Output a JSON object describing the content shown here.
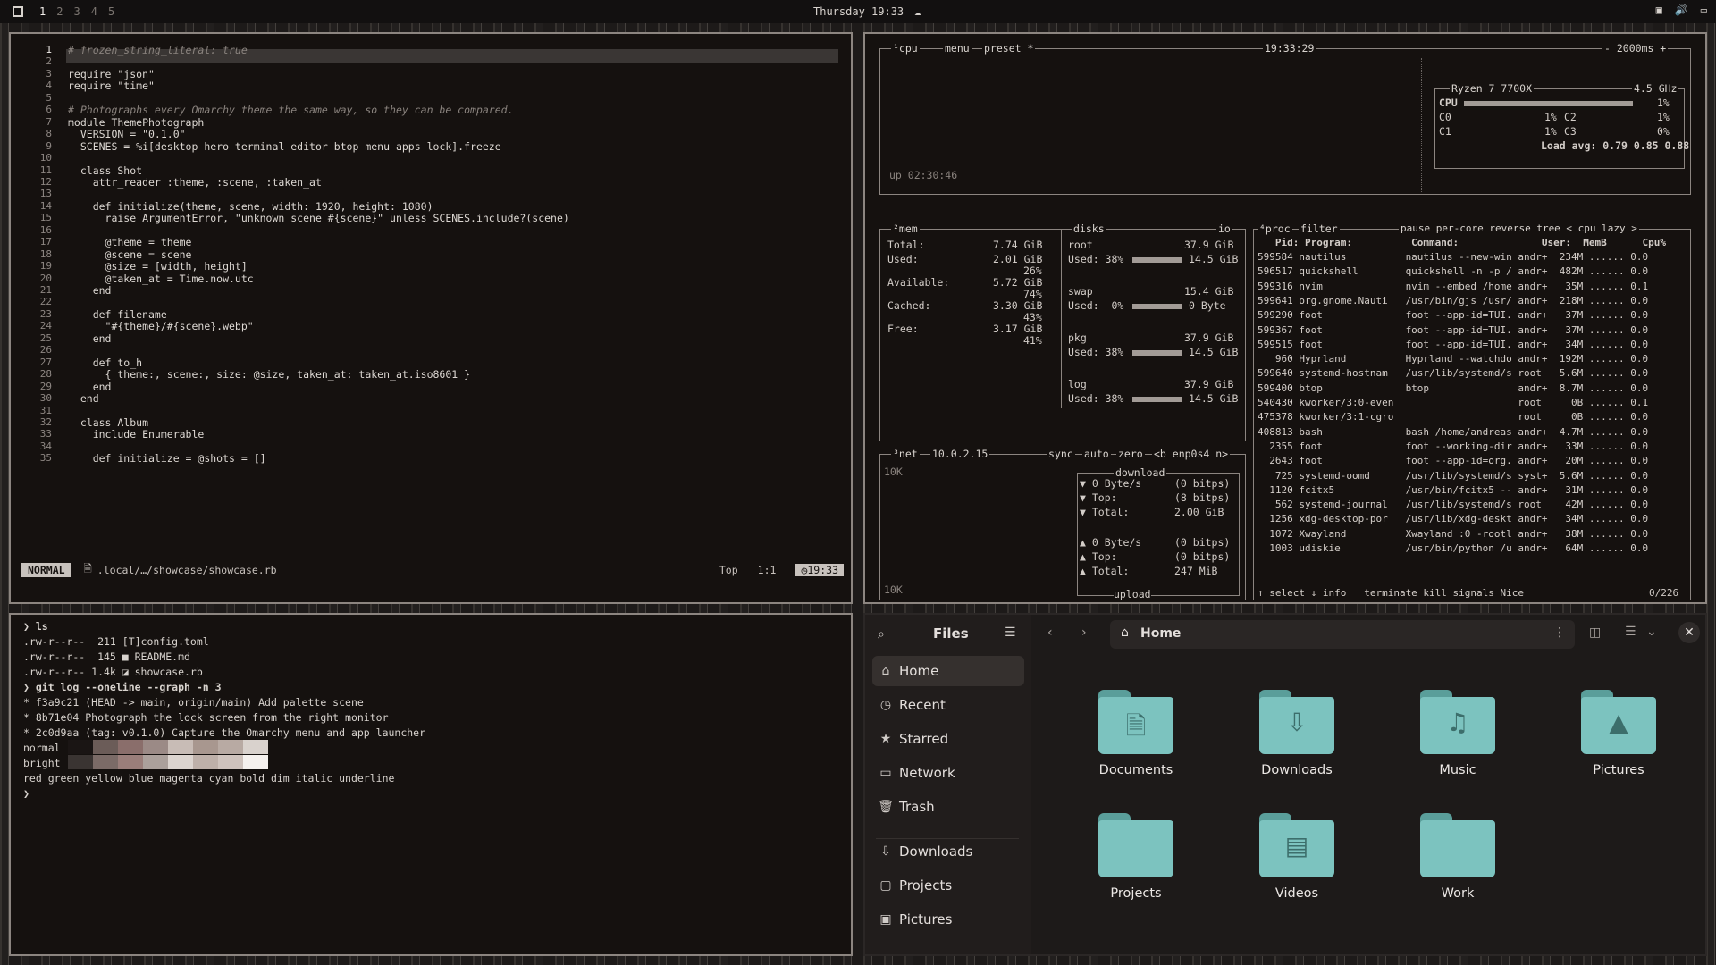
{
  "topbar": {
    "workspaces": [
      "1",
      "2",
      "3",
      "4",
      "5"
    ],
    "active": "1",
    "clock": "Thursday 19:33",
    "clock_icon": "cloud-icon",
    "tray": [
      "screen-icon",
      "volume-icon",
      "display-icon"
    ]
  },
  "editor": {
    "lines": [
      {
        "n": "1",
        "t": "# frozen_string_literal: true"
      },
      {
        "n": "2",
        "t": ""
      },
      {
        "n": "3",
        "t": "require \"json\""
      },
      {
        "n": "4",
        "t": "require \"time\""
      },
      {
        "n": "5",
        "t": ""
      },
      {
        "n": "6",
        "t": "# Photographs every Omarchy theme the same way, so they can be compared."
      },
      {
        "n": "7",
        "t": "module ThemePhotograph"
      },
      {
        "n": "8",
        "t": "  VERSION = \"0.1.0\""
      },
      {
        "n": "9",
        "t": "  SCENES = %i[desktop hero terminal editor btop menu apps lock].freeze"
      },
      {
        "n": "10",
        "t": ""
      },
      {
        "n": "11",
        "t": "  class Shot"
      },
      {
        "n": "12",
        "t": "    attr_reader :theme, :scene, :taken_at"
      },
      {
        "n": "13",
        "t": ""
      },
      {
        "n": "14",
        "t": "    def initialize(theme, scene, width: 1920, height: 1080)"
      },
      {
        "n": "15",
        "t": "      raise ArgumentError, \"unknown scene #{scene}\" unless SCENES.include?(scene)"
      },
      {
        "n": "16",
        "t": ""
      },
      {
        "n": "17",
        "t": "      @theme = theme"
      },
      {
        "n": "18",
        "t": "      @scene = scene"
      },
      {
        "n": "19",
        "t": "      @size = [width, height]"
      },
      {
        "n": "20",
        "t": "      @taken_at = Time.now.utc"
      },
      {
        "n": "21",
        "t": "    end"
      },
      {
        "n": "22",
        "t": ""
      },
      {
        "n": "23",
        "t": "    def filename"
      },
      {
        "n": "24",
        "t": "      \"#{theme}/#{scene}.webp\""
      },
      {
        "n": "25",
        "t": "    end"
      },
      {
        "n": "26",
        "t": ""
      },
      {
        "n": "27",
        "t": "    def to_h"
      },
      {
        "n": "28",
        "t": "      { theme:, scene:, size: @size, taken_at: taken_at.iso8601 }"
      },
      {
        "n": "29",
        "t": "    end"
      },
      {
        "n": "30",
        "t": "  end"
      },
      {
        "n": "31",
        "t": ""
      },
      {
        "n": "32",
        "t": "  class Album"
      },
      {
        "n": "33",
        "t": "    include Enumerable"
      },
      {
        "n": "34",
        "t": ""
      },
      {
        "n": "35",
        "t": "    def initialize = @shots = []"
      }
    ],
    "status": {
      "mode": "NORMAL",
      "path": ".local/…/showcase/showcase.rb",
      "pos": "Top",
      "cursor": "1:1",
      "time": "19:33"
    }
  },
  "terminal": {
    "lines": [
      "❯ ls",
      ".rw-r--r--  211 [T]config.toml",
      ".rw-r--r--  145 ■ README.md",
      ".rw-r--r-- 1.4k ◪ showcase.rb",
      "❯ git log --oneline --graph -n 3",
      "* f3a9c21 (HEAD -> main, origin/main) Add palette scene",
      "* 8b71e04 Photograph the lock screen from the right monitor",
      "* 2c0d9aa (tag: v0.1.0) Capture the Omarchy menu and app launcher",
      "normal",
      "bright",
      "red green yellow blue magenta cyan bold dim italic underline",
      "❯"
    ],
    "palette_normal": [
      "#1a1514",
      "#6b5c58",
      "#8a6e6b",
      "#9b8a86",
      "#c8bcb6",
      "#a8978f",
      "#b8aaa3",
      "#d9d2cd"
    ],
    "palette_bright": [
      "#3a3432",
      "#7b6b67",
      "#9a7e7a",
      "#aba09b",
      "#dcd4cf",
      "#beb0a9",
      "#cfc3bd",
      "#f5f1ee"
    ]
  },
  "btop": {
    "cpu": {
      "label": "¹cpu",
      "menu": "menu",
      "preset": "preset *",
      "time": "19:33:29",
      "interval": "- 2000ms +",
      "model": "Ryzen 7 7700X",
      "freq": "4.5 GHz",
      "uptime": "up 02:30:46",
      "rows": [
        {
          "name": "CPU",
          "pct": "1%",
          "fill": 0.9
        },
        {
          "name": "C0",
          "pct": "1%"
        },
        {
          "name": "C2",
          "pct": "1%"
        },
        {
          "name": "C1",
          "pct": "1%"
        },
        {
          "name": "C3",
          "pct": "0%"
        }
      ],
      "load": "Load avg: 0.79 0.85 0.88"
    },
    "mem": {
      "label": "²mem",
      "rows": [
        {
          "k": "Total:",
          "v": "7.74 GiB"
        },
        {
          "k": "Used:",
          "v": "2.01 GiB",
          "p": "26%"
        },
        {
          "k": "Available:",
          "v": "5.72 GiB",
          "p": "74%"
        },
        {
          "k": "Cached:",
          "v": "3.30 GiB",
          "p": "43%"
        },
        {
          "k": "Free:",
          "v": "3.17 GiB",
          "p": "41%"
        }
      ]
    },
    "disks": {
      "label": "disks",
      "io": "io",
      "rows": [
        {
          "name": "root",
          "size": "37.9 GiB",
          "used": "Used: 38%",
          "usize": "14.5 GiB"
        },
        {
          "name": "swap",
          "size": "15.4 GiB",
          "used": "Used:  0%",
          "usize": "0 Byte"
        },
        {
          "name": "pkg",
          "size": "37.9 GiB",
          "used": "Used: 38%",
          "usize": "14.5 GiB"
        },
        {
          "name": "log",
          "size": "37.9 GiB",
          "used": "Used: 38%",
          "usize": "14.5 GiB"
        }
      ]
    },
    "net": {
      "label": "³net",
      "ip": "10.0.2.15",
      "sync": "sync",
      "auto": "auto",
      "zero": "zero",
      "iface": "<b enp0s4 n>",
      "scale_top": "10K",
      "scale_bot": "10K",
      "download": "download",
      "upload": "upload",
      "down": [
        {
          "k": "▼ 0 Byte/s",
          "v": "(0 bitps)"
        },
        {
          "k": "▼ Top:",
          "v": "(8 bitps)"
        },
        {
          "k": "▼ Total:",
          "v": "2.00 GiB"
        }
      ],
      "up": [
        {
          "k": "▲ 0 Byte/s",
          "v": "(0 bitps)"
        },
        {
          "k": "▲ Top:",
          "v": "(0 bitps)"
        },
        {
          "k": "▲ Total:",
          "v": "247 MiB"
        }
      ]
    },
    "proc": {
      "label": "⁴proc",
      "header": "filter",
      "opts": "pause per-core reverse tree < cpu lazy >",
      "cols": "   Pid: Program:          Command:              User:  MemB      Cpu%",
      "rows": [
        "599584 nautilus          nautilus --new-win andr+  234M ...... 0.0",
        "596517 quickshell        quickshell -n -p / andr+  482M ...... 0.0",
        "599316 nvim              nvim --embed /home andr+   35M ...... 0.1",
        "599641 org.gnome.Nauti   /usr/bin/gjs /usr/ andr+  218M ...... 0.0",
        "599290 foot              foot --app-id=TUI. andr+   37M ...... 0.0",
        "599367 foot              foot --app-id=TUI. andr+   37M ...... 0.0",
        "599515 foot              foot --app-id=TUI. andr+   34M ...... 0.0",
        "   960 Hyprland          Hyprland --watchdo andr+  192M ...... 0.0",
        "599640 systemd-hostnam   /usr/lib/systemd/s root   5.6M ...... 0.0",
        "599400 btop              btop               andr+  8.7M ...... 0.0",
        "540430 kworker/3:0-even                     root     0B ...... 0.1",
        "475378 kworker/3:1-cgro                     root     0B ...... 0.0",
        "408813 bash              bash /home/andreas andr+  4.7M ...... 0.0",
        "  2355 foot              foot --working-dir andr+   33M ...... 0.0",
        "  2643 foot              foot --app-id=org. andr+   20M ...... 0.0",
        "   725 systemd-oomd      /usr/lib/systemd/s syst+  5.6M ...... 0.0",
        "  1120 fcitx5            /usr/bin/fcitx5 -- andr+   31M ...... 0.0",
        "   562 systemd-journal   /usr/lib/systemd/s root    42M ...... 0.0",
        "  1256 xdg-desktop-por   /usr/lib/xdg-deskt andr+   34M ...... 0.0",
        "  1072 Xwayland          Xwayland :0 -rootl andr+   38M ...... 0.0",
        "  1003 udiskie           /usr/bin/python /u andr+   64M ...... 0.0"
      ],
      "footer": "↑ select ↓ info   terminate kill signals Nice",
      "count": "0/226"
    }
  },
  "files": {
    "title": "Files",
    "location": "Home",
    "sidebar": [
      {
        "label": "Home",
        "icon": "home-icon",
        "glyph": "⌂",
        "sel": true
      },
      {
        "label": "Recent",
        "icon": "clock-icon",
        "glyph": "◷"
      },
      {
        "label": "Starred",
        "icon": "star-icon",
        "glyph": "★"
      },
      {
        "label": "Network",
        "icon": "network-icon",
        "glyph": "▭"
      },
      {
        "label": "Trash",
        "icon": "trash-icon",
        "glyph": "🗑"
      },
      {
        "label": "Downloads",
        "icon": "download-icon",
        "glyph": "⇩"
      },
      {
        "label": "Projects",
        "icon": "folder-icon",
        "glyph": "▢"
      },
      {
        "label": "Pictures",
        "icon": "picture-icon",
        "glyph": "▣"
      }
    ],
    "folders": [
      {
        "label": "Documents",
        "icon": "document-folder-icon",
        "glyph": "🗎"
      },
      {
        "label": "Downloads",
        "icon": "download-folder-icon",
        "glyph": "⇩"
      },
      {
        "label": "Music",
        "icon": "music-folder-icon",
        "glyph": "♫"
      },
      {
        "label": "Pictures",
        "icon": "pictures-folder-icon",
        "glyph": "▲"
      },
      {
        "label": "Projects",
        "icon": "folder-icon",
        "glyph": ""
      },
      {
        "label": "Videos",
        "icon": "video-folder-icon",
        "glyph": "▤"
      },
      {
        "label": "Work",
        "icon": "folder-icon",
        "glyph": ""
      }
    ]
  }
}
